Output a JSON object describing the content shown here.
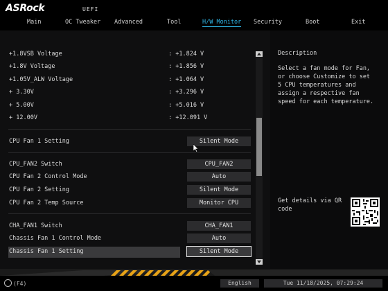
{
  "brand": {
    "logo": "ASRock",
    "uefi": "UEFI"
  },
  "tabs": [
    {
      "label": "Main"
    },
    {
      "label": "OC Tweaker"
    },
    {
      "label": "Advanced"
    },
    {
      "label": "Tool"
    },
    {
      "label": "H/W Monitor",
      "active": true
    },
    {
      "label": "Security"
    },
    {
      "label": "Boot"
    },
    {
      "label": "Exit"
    }
  ],
  "voltages": [
    {
      "label": "+1.8VSB Voltage",
      "value": ": +1.824 V"
    },
    {
      "label": "+1.8V Voltage",
      "value": ": +1.856 V"
    },
    {
      "label": "+1.05V_ALW Voltage",
      "value": ": +1.064 V"
    },
    {
      "label": "+ 3.30V",
      "value": ": +3.296 V"
    },
    {
      "label": "+ 5.00V",
      "value": ": +5.016 V"
    },
    {
      "label": "+ 12.00V",
      "value": ": +12.091 V"
    }
  ],
  "cpu_fan1": {
    "label": "CPU Fan 1 Setting",
    "value": "Silent Mode"
  },
  "cpu_fan2": [
    {
      "label": "CPU_FAN2 Switch",
      "value": "CPU_FAN2"
    },
    {
      "label": "CPU Fan 2 Control Mode",
      "value": "Auto"
    },
    {
      "label": "CPU Fan 2 Setting",
      "value": "Silent Mode"
    },
    {
      "label": "CPU Fan 2 Temp Source",
      "value": "Monitor CPU"
    }
  ],
  "cha_fan1": [
    {
      "label": "CHA_FAN1 Switch",
      "value": "CHA_FAN1"
    },
    {
      "label": "Chassis Fan 1 Control Mode",
      "value": "Auto"
    },
    {
      "label": "Chassis Fan 1 Setting",
      "value": "Silent Mode"
    }
  ],
  "description": {
    "title": "Description",
    "text": "Select a fan mode for Fan, or choose Customize to set 5 CPU temperatures and assign a respective fan speed for each temperature.",
    "qr_text": "Get details via QR code"
  },
  "footer": {
    "fkey": "(F4)",
    "language": "English",
    "datetime": "Tue 11/18/2025, 07:29:24"
  },
  "colors": {
    "accent": "#2fb5e6",
    "stripe": "#e8a317"
  }
}
